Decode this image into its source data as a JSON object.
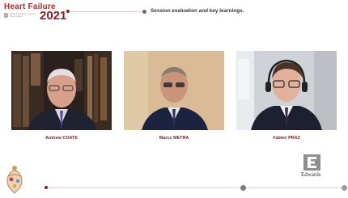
{
  "logo": {
    "word": "Heart Failure",
    "year": "2021",
    "subtitle": "World Congress on Acute Heart Failure"
  },
  "session": {
    "title": "Session evaluation and key learnings."
  },
  "panelists": [
    {
      "name": "Andrew COATS"
    },
    {
      "name": "Marco METRA"
    },
    {
      "name": "Fabien PRAZ"
    }
  ],
  "sponsor": {
    "name": "Edwards"
  },
  "colors": {
    "brand_red": "#8a1c26",
    "name_red": "#7a1f24",
    "progress": "#7c7c7c"
  }
}
